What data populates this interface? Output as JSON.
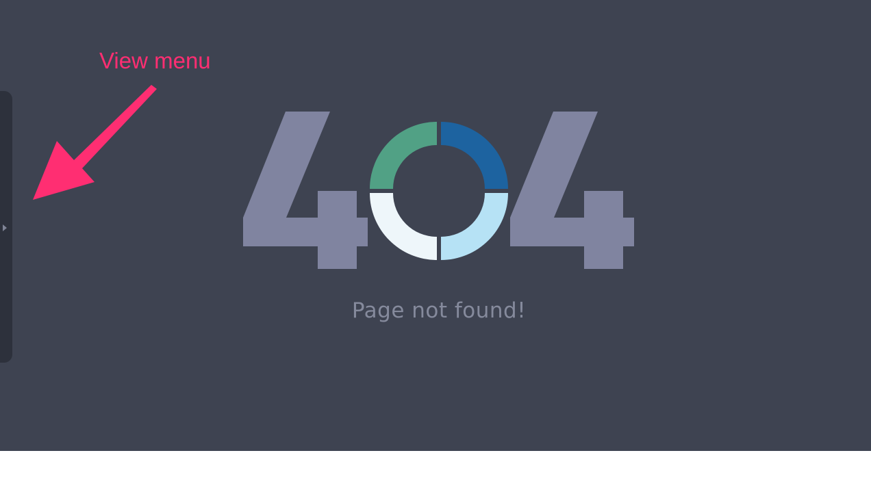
{
  "annotation": {
    "label": "View menu",
    "color": "#ff2e72"
  },
  "sidebar": {
    "toggle_icon": "chevron-right-icon"
  },
  "error": {
    "code_first_digit": "4",
    "code_second_digit": "0",
    "code_third_digit": "4",
    "message": "Page not found!",
    "digit_color": "#8084a0",
    "ring_colors": {
      "top_left": "#51a185",
      "top_right": "#1d63a0",
      "bottom_left": "#eef6fa",
      "bottom_right": "#b6e2f5"
    }
  },
  "colors": {
    "background": "#3e4351",
    "sidebar": "#2d313c"
  }
}
